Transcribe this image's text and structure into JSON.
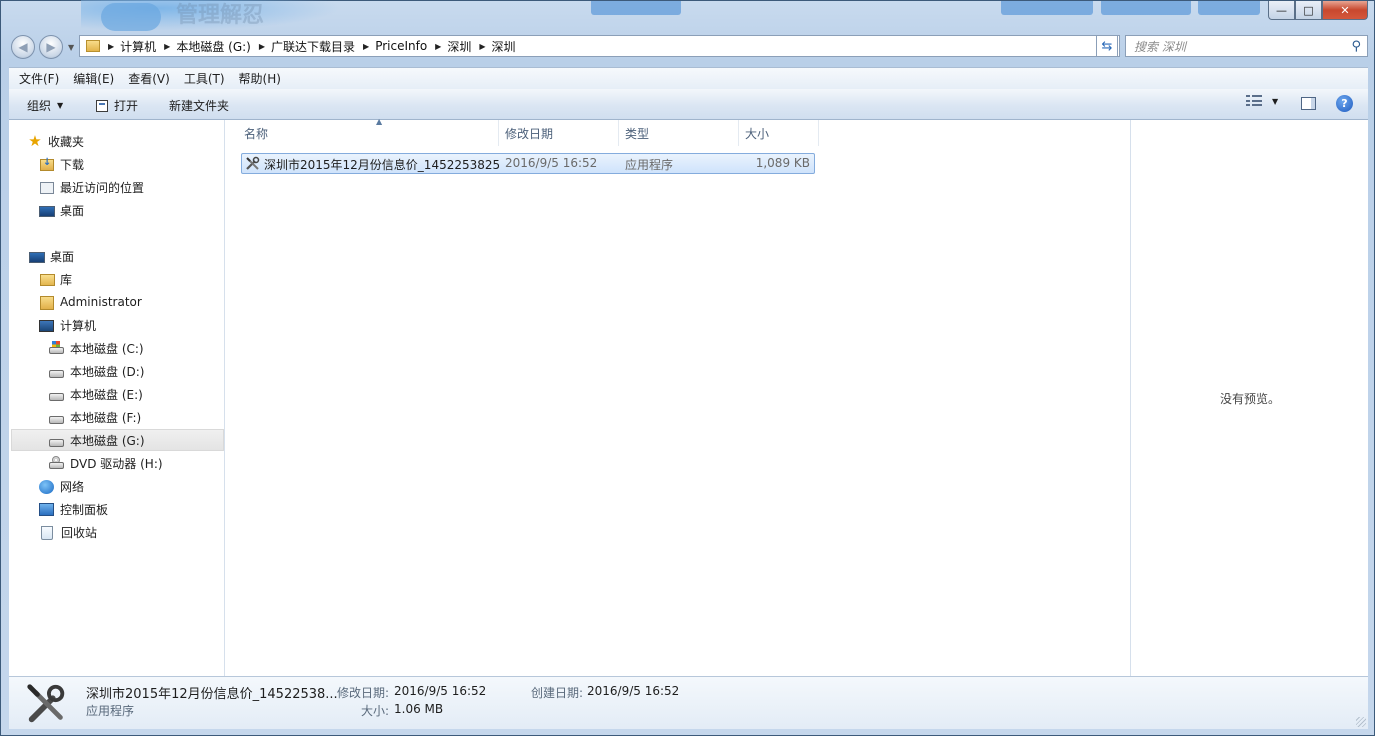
{
  "window": {
    "title_ghost_text": "管理解忍",
    "controls": {
      "minimize": "—",
      "maximize": "□",
      "close": "✕"
    }
  },
  "address": {
    "crumbs": [
      "计算机",
      "本地磁盘 (G:)",
      "广联达下载目录",
      "PriceInfo",
      "深圳",
      "深圳"
    ]
  },
  "search": {
    "placeholder": "搜索 深圳"
  },
  "menu": [
    "文件(F)",
    "编辑(E)",
    "查看(V)",
    "工具(T)",
    "帮助(H)"
  ],
  "toolbar": {
    "organize": "组织",
    "open": "打开",
    "new_folder": "新建文件夹"
  },
  "nav": {
    "favorites": "收藏夹",
    "downloads": "下载",
    "recent": "最近访问的位置",
    "desktop_fav": "桌面",
    "desktop": "桌面",
    "libraries": "库",
    "user": "Administrator",
    "computer": "计算机",
    "drive_c": "本地磁盘 (C:)",
    "drive_d": "本地磁盘 (D:)",
    "drive_e": "本地磁盘 (E:)",
    "drive_f": "本地磁盘 (F:)",
    "drive_g": "本地磁盘 (G:)",
    "dvd": "DVD 驱动器 (H:)",
    "network": "网络",
    "control_panel": "控制面板",
    "recycle_bin": "回收站"
  },
  "columns": {
    "name": "名称",
    "modified": "修改日期",
    "type": "类型",
    "size": "大小"
  },
  "files": [
    {
      "name": "深圳市2015年12月份信息价_1452253825",
      "modified": "2016/9/5 16:52",
      "type": "应用程序",
      "size": "1,089 KB"
    }
  ],
  "preview": {
    "empty_text": "没有预览。"
  },
  "status": {
    "filename": "深圳市2015年12月份信息价_14522538...",
    "type": "应用程序",
    "modified_label": "修改日期:",
    "modified": "2016/9/5 16:52",
    "created_label": "创建日期:",
    "created": "2016/9/5 16:52",
    "size_label": "大小:",
    "size": "1.06 MB"
  },
  "colors": {
    "selection_bg": "#cfe3fb",
    "selection_border": "#84acdd",
    "frame": "#b9cfe8"
  }
}
